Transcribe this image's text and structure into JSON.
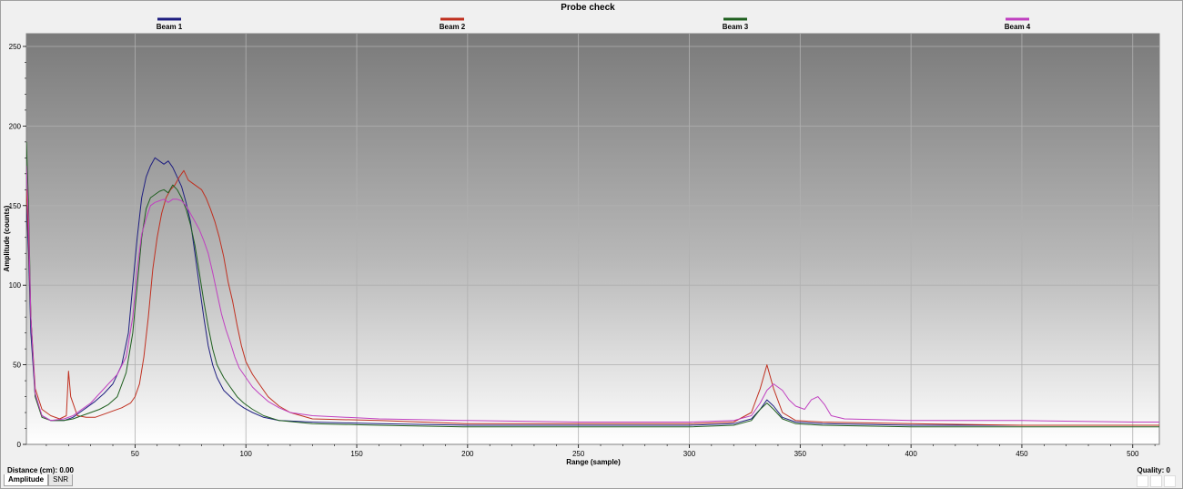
{
  "status": {
    "distance_label": "Distance (cm):",
    "distance_value": "0.00",
    "quality_label": "Quality:",
    "quality_value": "0"
  },
  "tabs": [
    {
      "label": "Amplitude",
      "active": true
    },
    {
      "label": "SNR",
      "active": false
    }
  ],
  "chart_data": {
    "type": "line",
    "title": "Probe check",
    "xlabel": "Range (sample)",
    "ylabel": "Amplitude (counts)",
    "xlim": [
      1,
      512
    ],
    "ylim": [
      0,
      258
    ],
    "xticks": [
      50,
      100,
      150,
      200,
      250,
      300,
      350,
      400,
      450,
      500
    ],
    "yticks": [
      0,
      50,
      100,
      150,
      200,
      250
    ],
    "grid": true,
    "legend_position": "top",
    "series": [
      {
        "name": "Beam 1",
        "color": "#1f1f80",
        "points": [
          [
            1,
            150
          ],
          [
            2,
            120
          ],
          [
            3,
            70
          ],
          [
            5,
            30
          ],
          [
            8,
            18
          ],
          [
            12,
            15
          ],
          [
            18,
            15
          ],
          [
            22,
            17
          ],
          [
            25,
            20
          ],
          [
            28,
            23
          ],
          [
            32,
            27
          ],
          [
            36,
            32
          ],
          [
            40,
            38
          ],
          [
            44,
            50
          ],
          [
            47,
            70
          ],
          [
            49,
            100
          ],
          [
            51,
            130
          ],
          [
            53,
            155
          ],
          [
            55,
            168
          ],
          [
            57,
            175
          ],
          [
            59,
            180
          ],
          [
            61,
            178
          ],
          [
            63,
            176
          ],
          [
            65,
            178
          ],
          [
            67,
            174
          ],
          [
            69,
            168
          ],
          [
            71,
            162
          ],
          [
            73,
            152
          ],
          [
            75,
            140
          ],
          [
            77,
            120
          ],
          [
            79,
            100
          ],
          [
            81,
            80
          ],
          [
            83,
            62
          ],
          [
            85,
            50
          ],
          [
            87,
            42
          ],
          [
            90,
            34
          ],
          [
            93,
            30
          ],
          [
            96,
            26
          ],
          [
            99,
            23
          ],
          [
            103,
            20
          ],
          [
            108,
            17
          ],
          [
            115,
            15
          ],
          [
            130,
            14
          ],
          [
            160,
            13
          ],
          [
            200,
            12
          ],
          [
            250,
            12
          ],
          [
            300,
            12
          ],
          [
            320,
            13
          ],
          [
            328,
            16
          ],
          [
            332,
            22
          ],
          [
            335,
            28
          ],
          [
            338,
            24
          ],
          [
            342,
            17
          ],
          [
            348,
            14
          ],
          [
            360,
            13
          ],
          [
            400,
            12
          ],
          [
            450,
            12
          ],
          [
            500,
            12
          ],
          [
            512,
            12
          ]
        ]
      },
      {
        "name": "Beam 2",
        "color": "#c03020",
        "points": [
          [
            1,
            160
          ],
          [
            2,
            130
          ],
          [
            3,
            80
          ],
          [
            5,
            35
          ],
          [
            8,
            22
          ],
          [
            12,
            18
          ],
          [
            16,
            16
          ],
          [
            19,
            18
          ],
          [
            20,
            46
          ],
          [
            21,
            30
          ],
          [
            24,
            18
          ],
          [
            28,
            17
          ],
          [
            32,
            17
          ],
          [
            36,
            19
          ],
          [
            40,
            21
          ],
          [
            44,
            23
          ],
          [
            48,
            26
          ],
          [
            50,
            30
          ],
          [
            52,
            38
          ],
          [
            54,
            55
          ],
          [
            56,
            80
          ],
          [
            58,
            110
          ],
          [
            60,
            130
          ],
          [
            62,
            145
          ],
          [
            64,
            155
          ],
          [
            66,
            160
          ],
          [
            68,
            163
          ],
          [
            70,
            168
          ],
          [
            72,
            172
          ],
          [
            74,
            166
          ],
          [
            76,
            164
          ],
          [
            78,
            162
          ],
          [
            80,
            160
          ],
          [
            82,
            155
          ],
          [
            84,
            148
          ],
          [
            86,
            140
          ],
          [
            88,
            130
          ],
          [
            90,
            118
          ],
          [
            92,
            102
          ],
          [
            94,
            90
          ],
          [
            96,
            75
          ],
          [
            98,
            62
          ],
          [
            100,
            52
          ],
          [
            103,
            44
          ],
          [
            106,
            38
          ],
          [
            110,
            30
          ],
          [
            115,
            24
          ],
          [
            120,
            20
          ],
          [
            130,
            16
          ],
          [
            160,
            15
          ],
          [
            200,
            13
          ],
          [
            250,
            13
          ],
          [
            300,
            13
          ],
          [
            320,
            14
          ],
          [
            328,
            20
          ],
          [
            332,
            35
          ],
          [
            335,
            50
          ],
          [
            338,
            35
          ],
          [
            342,
            20
          ],
          [
            348,
            15
          ],
          [
            360,
            14
          ],
          [
            400,
            13
          ],
          [
            450,
            12
          ],
          [
            500,
            12
          ],
          [
            512,
            12
          ]
        ]
      },
      {
        "name": "Beam 3",
        "color": "#206020",
        "points": [
          [
            1,
            190
          ],
          [
            2,
            150
          ],
          [
            3,
            80
          ],
          [
            5,
            30
          ],
          [
            8,
            17
          ],
          [
            12,
            15
          ],
          [
            18,
            15
          ],
          [
            22,
            16
          ],
          [
            26,
            18
          ],
          [
            30,
            20
          ],
          [
            34,
            22
          ],
          [
            38,
            25
          ],
          [
            42,
            30
          ],
          [
            46,
            45
          ],
          [
            49,
            70
          ],
          [
            51,
            100
          ],
          [
            53,
            130
          ],
          [
            55,
            148
          ],
          [
            57,
            155
          ],
          [
            59,
            157
          ],
          [
            61,
            159
          ],
          [
            63,
            160
          ],
          [
            65,
            158
          ],
          [
            67,
            163
          ],
          [
            69,
            160
          ],
          [
            71,
            155
          ],
          [
            73,
            148
          ],
          [
            75,
            138
          ],
          [
            77,
            125
          ],
          [
            79,
            108
          ],
          [
            81,
            90
          ],
          [
            83,
            74
          ],
          [
            85,
            60
          ],
          [
            87,
            50
          ],
          [
            90,
            42
          ],
          [
            93,
            36
          ],
          [
            96,
            30
          ],
          [
            99,
            26
          ],
          [
            103,
            22
          ],
          [
            108,
            18
          ],
          [
            115,
            15
          ],
          [
            130,
            13
          ],
          [
            160,
            12
          ],
          [
            200,
            11
          ],
          [
            250,
            11
          ],
          [
            300,
            11
          ],
          [
            320,
            12
          ],
          [
            328,
            15
          ],
          [
            332,
            22
          ],
          [
            335,
            26
          ],
          [
            338,
            22
          ],
          [
            342,
            16
          ],
          [
            348,
            13
          ],
          [
            360,
            12
          ],
          [
            400,
            11
          ],
          [
            450,
            11
          ],
          [
            500,
            11
          ],
          [
            512,
            11
          ]
        ]
      },
      {
        "name": "Beam 4",
        "color": "#c040c0",
        "points": [
          [
            1,
            175
          ],
          [
            2,
            140
          ],
          [
            3,
            80
          ],
          [
            5,
            32
          ],
          [
            8,
            18
          ],
          [
            12,
            15
          ],
          [
            18,
            16
          ],
          [
            22,
            18
          ],
          [
            26,
            22
          ],
          [
            30,
            26
          ],
          [
            34,
            32
          ],
          [
            38,
            38
          ],
          [
            42,
            44
          ],
          [
            46,
            55
          ],
          [
            49,
            80
          ],
          [
            51,
            110
          ],
          [
            53,
            132
          ],
          [
            55,
            142
          ],
          [
            57,
            150
          ],
          [
            59,
            152
          ],
          [
            61,
            153
          ],
          [
            63,
            154
          ],
          [
            65,
            152
          ],
          [
            67,
            154
          ],
          [
            69,
            154
          ],
          [
            71,
            153
          ],
          [
            73,
            150
          ],
          [
            75,
            145
          ],
          [
            77,
            140
          ],
          [
            79,
            135
          ],
          [
            81,
            128
          ],
          [
            83,
            120
          ],
          [
            85,
            108
          ],
          [
            87,
            95
          ],
          [
            89,
            82
          ],
          [
            91,
            72
          ],
          [
            93,
            64
          ],
          [
            95,
            55
          ],
          [
            97,
            48
          ],
          [
            100,
            42
          ],
          [
            103,
            36
          ],
          [
            106,
            32
          ],
          [
            110,
            27
          ],
          [
            115,
            23
          ],
          [
            120,
            20
          ],
          [
            130,
            18
          ],
          [
            160,
            16
          ],
          [
            200,
            15
          ],
          [
            250,
            14
          ],
          [
            300,
            14
          ],
          [
            320,
            15
          ],
          [
            328,
            18
          ],
          [
            332,
            26
          ],
          [
            335,
            34
          ],
          [
            338,
            38
          ],
          [
            342,
            34
          ],
          [
            345,
            28
          ],
          [
            348,
            24
          ],
          [
            352,
            22
          ],
          [
            355,
            28
          ],
          [
            358,
            30
          ],
          [
            361,
            25
          ],
          [
            364,
            18
          ],
          [
            370,
            16
          ],
          [
            400,
            15
          ],
          [
            450,
            15
          ],
          [
            500,
            14
          ],
          [
            512,
            14
          ]
        ]
      }
    ]
  }
}
